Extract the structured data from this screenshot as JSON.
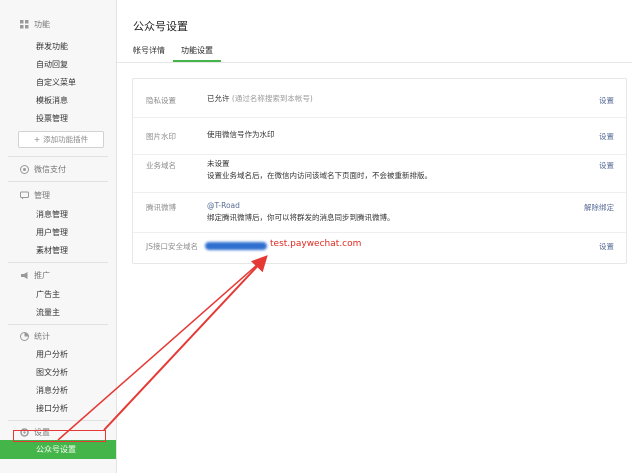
{
  "sidebar": {
    "sections": [
      {
        "title": "功能",
        "icon": "grid-icon",
        "items": [
          "群发功能",
          "自动回复",
          "自定义菜单",
          "模板消息",
          "投票管理"
        ]
      },
      {
        "title": "微信支付",
        "icon": "wechat-pay-icon",
        "items": []
      },
      {
        "title": "管理",
        "icon": "chat-icon",
        "items": [
          "消息管理",
          "用户管理",
          "素材管理"
        ]
      },
      {
        "title": "推广",
        "icon": "megaphone-icon",
        "items": [
          "广告主",
          "流量主"
        ]
      },
      {
        "title": "统计",
        "icon": "chart-icon",
        "items": [
          "用户分析",
          "图文分析",
          "消息分析",
          "接口分析"
        ]
      },
      {
        "title": "设置",
        "icon": "gear-icon",
        "items": [
          "公众号设置"
        ]
      }
    ],
    "add_plugin_label": "添加功能插件",
    "active_item": "公众号设置"
  },
  "main": {
    "title": "公众号设置",
    "tabs": [
      {
        "label": "帐号详情",
        "active": false
      },
      {
        "label": "功能设置",
        "active": true
      }
    ]
  },
  "settings": [
    {
      "label": "隐私设置",
      "value": "已允许",
      "note": "(通过名称搜索到本帐号)",
      "action": "设置"
    },
    {
      "label": "图片水印",
      "value": "使用微信号作为水印",
      "action": "设置"
    },
    {
      "label": "业务域名",
      "value": "未设置",
      "desc": "设置业务域名后，在微信内访问该域名下页面时，不会被重新排版。",
      "action": "设置"
    },
    {
      "label": "腾讯微博",
      "value": "@T-Road",
      "desc": "绑定腾讯微博后，你可以将群发的消息同步到腾讯微博。",
      "action": "解除绑定"
    },
    {
      "label": "JS接口安全域名",
      "value": "test.paywechat.com",
      "action": "设置"
    }
  ],
  "colors": {
    "accent": "#44b549",
    "link": "#576b95",
    "annotation": "#e0281f"
  }
}
